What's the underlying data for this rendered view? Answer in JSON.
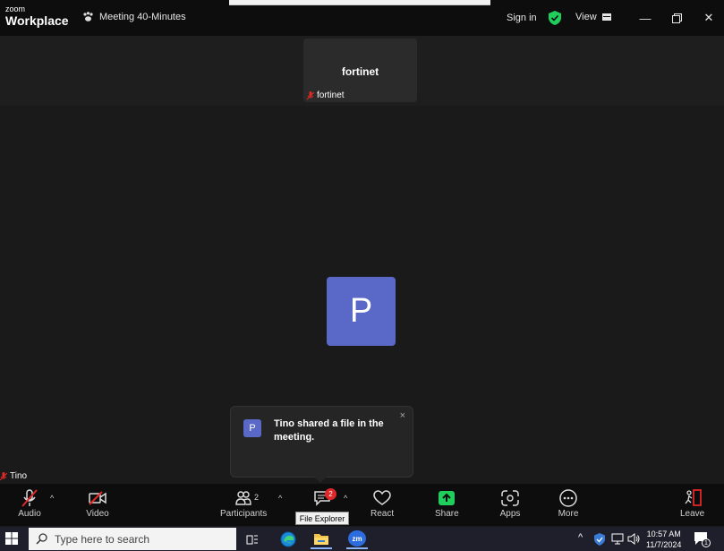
{
  "app": {
    "brand_small": "zoom",
    "brand_large": "Workplace",
    "meeting_label": "Meeting 40-Minutes",
    "sign_in": "Sign in",
    "view_label": "View"
  },
  "participants_strip": {
    "tile_name": "fortinet",
    "tile_tag": "fortinet"
  },
  "stage": {
    "avatar_letter": "P",
    "self_name": "Tino"
  },
  "toast": {
    "avatar_letter": "P",
    "message": "Tino shared a file in the meeting.",
    "close": "×"
  },
  "toolbar": {
    "audio": "Audio",
    "video": "Video",
    "participants": "Participants",
    "participants_count": "2",
    "chat_badge": "2",
    "react": "React",
    "share": "Share",
    "apps": "Apps",
    "more": "More",
    "leave": "Leave",
    "tooltip": "File Explorer"
  },
  "taskbar": {
    "search_placeholder": "Type here to search",
    "zoom_icon_text": "zm",
    "time": "10:57 AM",
    "date": "11/7/2024",
    "notif_count": "1"
  },
  "colors": {
    "accent_avatar": "#5a68c8",
    "share_green": "#1fce5b",
    "muted_red": "#e02828"
  }
}
